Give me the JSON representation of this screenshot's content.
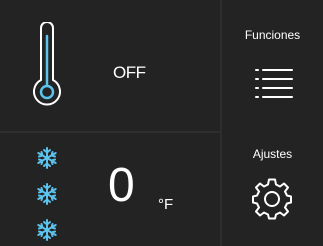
{
  "temperature_panel": {
    "icon": "thermometer-icon",
    "status": "OFF"
  },
  "freezer_panel": {
    "icon": "snowflake-icon",
    "value": "0",
    "unit": "°F"
  },
  "functions_panel": {
    "label": "Funciones",
    "icon": "menu-icon"
  },
  "settings_panel": {
    "label": "Ajustes",
    "icon": "gear-icon"
  },
  "colors": {
    "background": "#232323",
    "divider": "#2e2e2e",
    "text": "#ffffff",
    "accent_blue": "#5bc3ee"
  }
}
